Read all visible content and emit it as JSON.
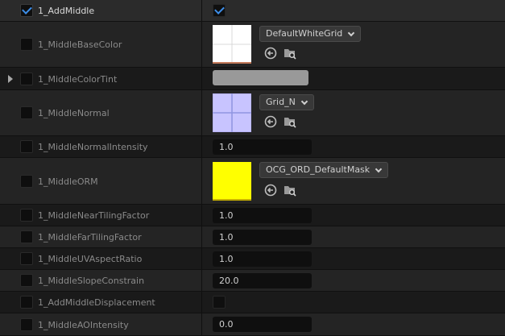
{
  "rows": {
    "add_middle": {
      "label": "1_AddMiddle",
      "enabled": true,
      "value": true
    },
    "base_color": {
      "label": "1_MiddleBaseColor",
      "texture": "DefaultWhiteGrid"
    },
    "color_tint": {
      "label": "1_MiddleColorTint",
      "color": "#999999"
    },
    "normal": {
      "label": "1_MiddleNormal",
      "texture": "Grid_N"
    },
    "normal_intensity": {
      "label": "1_MiddleNormalIntensity",
      "value": "1.0"
    },
    "orm": {
      "label": "1_MiddleORM",
      "texture": "OCG_ORD_DefaultMask"
    },
    "near_tiling": {
      "label": "1_MiddleNearTilingFactor",
      "value": "1.0"
    },
    "far_tiling": {
      "label": "1_MiddleFarTilingFactor",
      "value": "1.0"
    },
    "uv_aspect": {
      "label": "1_MiddleUVAspectRatio",
      "value": "1.0"
    },
    "slope": {
      "label": "1_MiddleSlopeConstrain",
      "value": "20.0"
    },
    "displacement": {
      "label": "1_AddMiddleDisplacement"
    },
    "ao": {
      "label": "1_MiddleAOIntensity",
      "value": "0.0"
    }
  },
  "icons": {
    "reset": "arrow-left-circle-icon",
    "browse": "folder-search-icon"
  },
  "colors": {
    "accent": "#3d8ee8",
    "orm_swatch": "#ffff00",
    "normal_swatch": "#c8c4ff"
  }
}
